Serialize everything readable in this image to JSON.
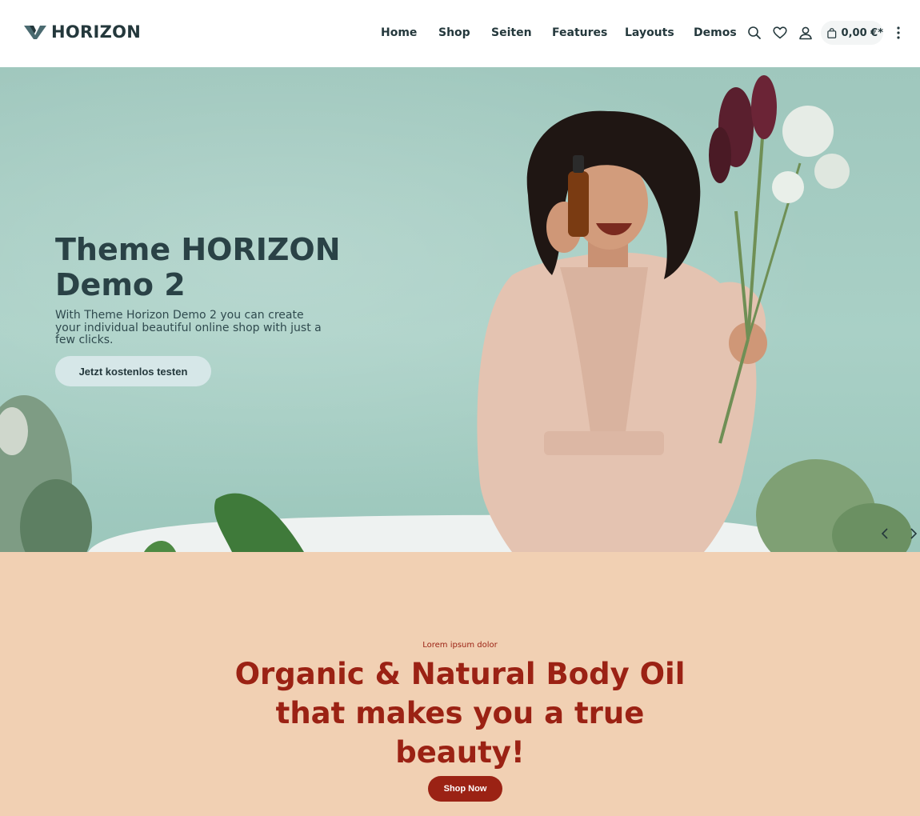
{
  "brand": {
    "name": "HORIZON"
  },
  "nav": {
    "items": [
      {
        "label": "Home"
      },
      {
        "label": "Shop"
      },
      {
        "label": "Seiten"
      },
      {
        "label": "Features"
      },
      {
        "label": "Layouts"
      },
      {
        "label": "Demos"
      }
    ]
  },
  "header_actions": {
    "icons": [
      "search-icon",
      "heart-icon",
      "user-icon",
      "bag-icon",
      "more-icon"
    ],
    "cart_total": "0,00 €*"
  },
  "hero": {
    "title": "Theme HORIZON Demo 2",
    "subtitle": "With Theme Horizon Demo 2 you can create your individual beautiful online shop with just a few clicks.",
    "cta_label": "Jetzt kostenlos testen"
  },
  "promo": {
    "eyebrow": "Lorem ipsum dolor",
    "title": "Organic & Natural Body Oil that makes you a true beauty!",
    "cta_label": "Shop Now"
  },
  "colors": {
    "text_dark": "#24383c",
    "hero_bg": "#a9d0c6",
    "promo_bg": "#f1d0b3",
    "accent_red": "#9b2214",
    "cta_light": "#d6e7e8"
  }
}
